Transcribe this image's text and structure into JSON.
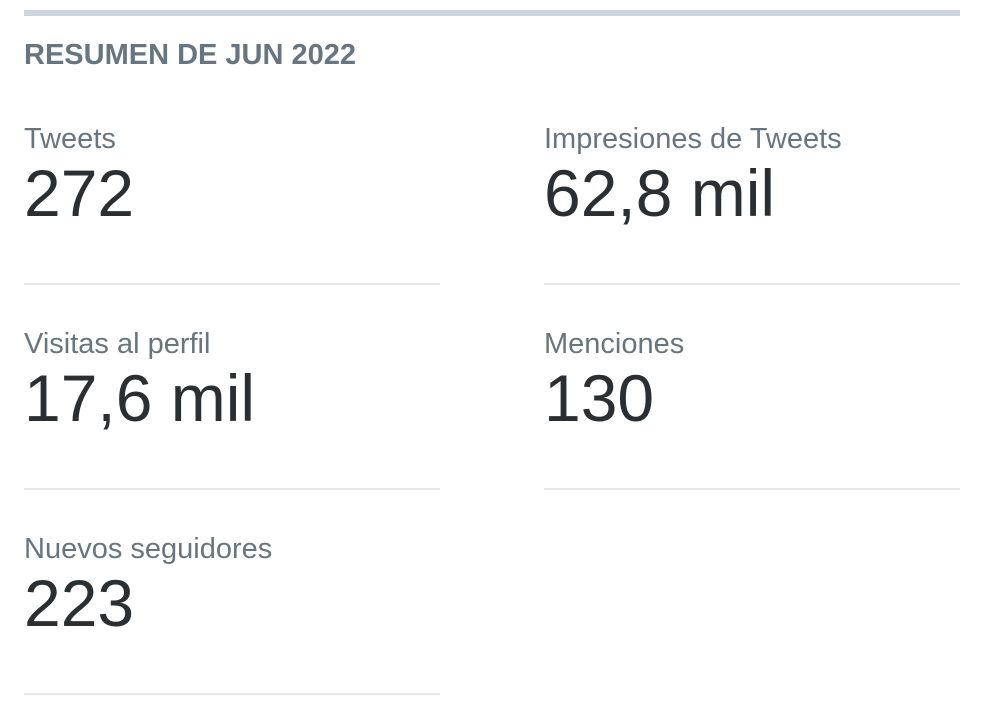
{
  "summary": {
    "title": "RESUMEN DE JUN 2022"
  },
  "stats": {
    "tweets": {
      "label": "Tweets",
      "value": "272"
    },
    "impressions": {
      "label": "Impresiones de Tweets",
      "value": "62,8 mil"
    },
    "profile_visits": {
      "label": "Visitas al perfil",
      "value": "17,6 mil"
    },
    "mentions": {
      "label": "Menciones",
      "value": "130"
    },
    "new_followers": {
      "label": "Nuevos seguidores",
      "value": "223"
    }
  },
  "colors": {
    "label": "#66757f",
    "value": "#292f33",
    "divider": "#e1e8ed",
    "top_rule": "#ccd6dd"
  }
}
